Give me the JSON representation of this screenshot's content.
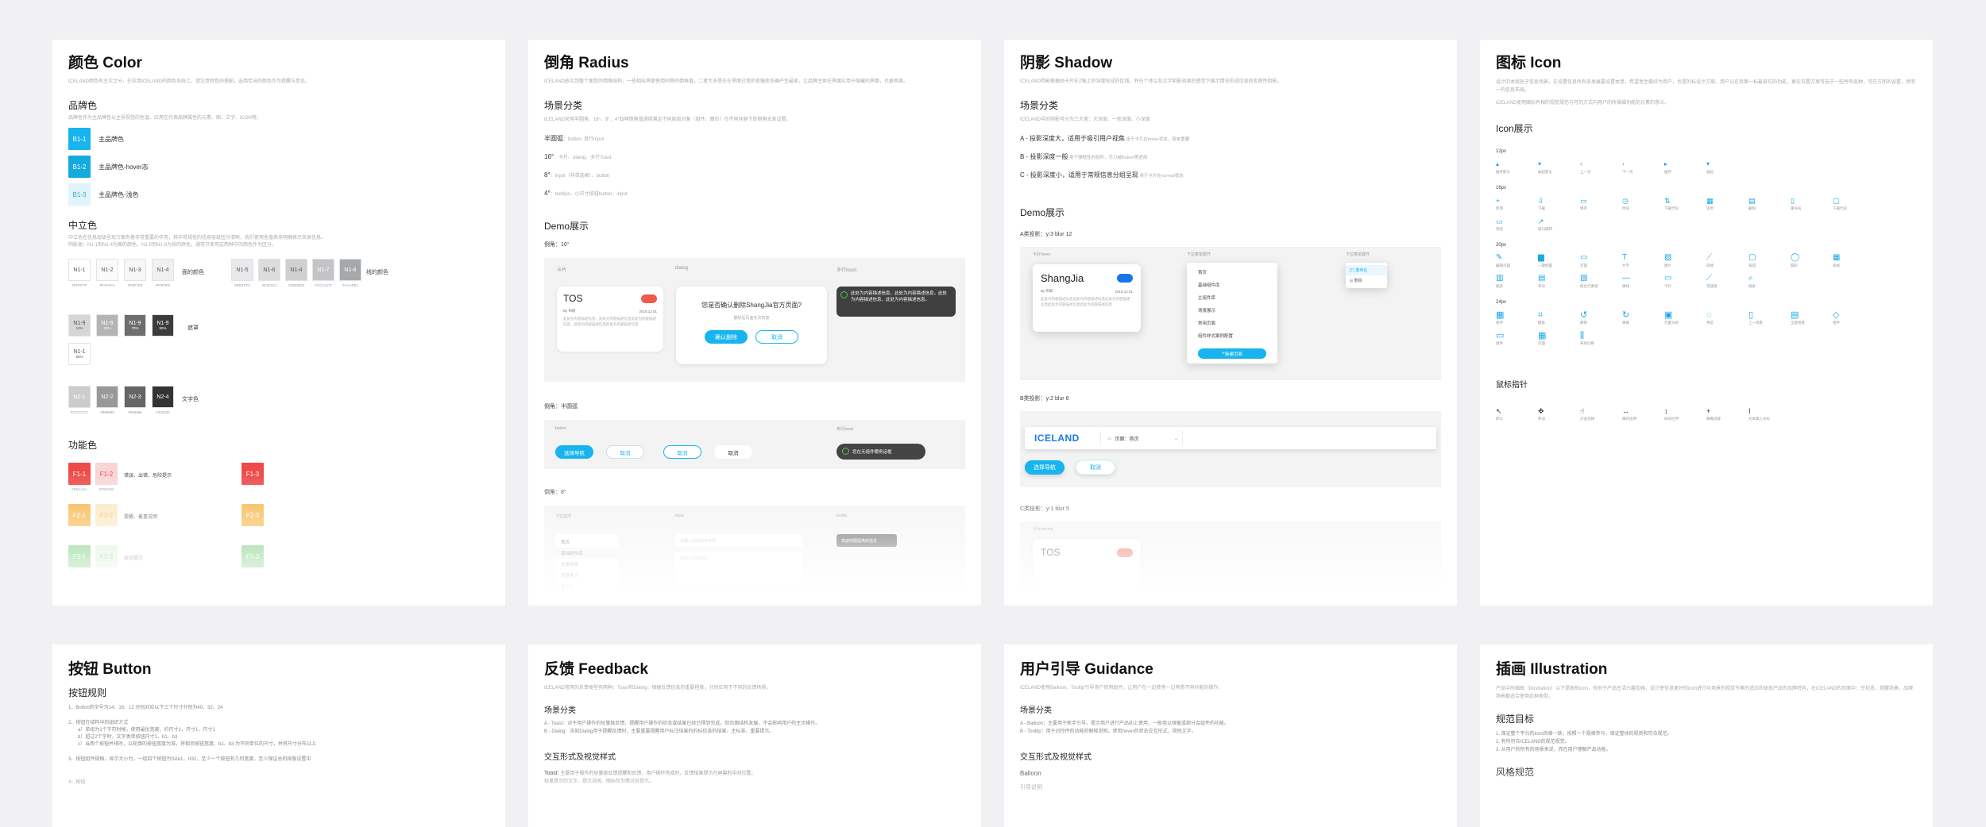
{
  "colors": {
    "blue1": "#18b4ee",
    "blue2": "#14aadd",
    "blue3": "#dff4fc",
    "red": "#ef4a4a",
    "orange": "#f6b13d",
    "green": "#56c05a",
    "dark": "#3a3a3a"
  },
  "color_card": {
    "title": "颜色 Color",
    "intro": "ICELAND颜色有主次之分，在应用ICELAND的颜色系统上，请注意颜色的搭配，选用恰当的颜色作为提醒与意见。",
    "brand_title": "品牌色",
    "brand_desc": "品牌色作为主品牌色以主导视觉的色温，应用在代表品牌属性的元素、图、文字、ICON等。",
    "brand": [
      {
        "code": "B1-1",
        "label": "主品牌色"
      },
      {
        "code": "B1-2",
        "label": "主品牌色-hover态"
      },
      {
        "code": "B1-3",
        "label": "主品牌色-浅色"
      }
    ],
    "neutral_title": "中立色",
    "neutral_desc": "中立色在信息层级呈现方面有着非常重要的作用，其中常规色的信息层级区分清晰，我们使用色值表来明确表示各类信息。",
    "neutral_desc2": "阴影类：N1-1到N1-4为面的颜色，N1-5到N1-8为线的颜色，通常只使用这两种中的颜色作为区分。",
    "face_label": "面的颜色",
    "line_label": "线的颜色",
    "face": [
      {
        "code": "N1-1",
        "hex": "#FFFFFF"
      },
      {
        "code": "N1-2",
        "hex": "#FAFAFA"
      },
      {
        "code": "N1-3",
        "hex": "#F6F7F8"
      },
      {
        "code": "N1-4",
        "hex": "#F0F0F0"
      }
    ],
    "line": [
      {
        "code": "N1-5",
        "hex": "#EEEFF2"
      },
      {
        "code": "N1-6",
        "hex": "#E1E1E1"
      },
      {
        "code": "N1-4",
        "hex": "#D6D6D6"
      },
      {
        "code": "N1-7",
        "hex": "#CCCACF"
      },
      {
        "code": "N1-8",
        "hex": "#AAAFB1"
      }
    ],
    "mask_label": "遮罩",
    "mask": [
      {
        "code": "N1-9",
        "sub": "10%"
      },
      {
        "code": "N1-9",
        "sub": "30%"
      },
      {
        "code": "N1-9",
        "sub": "70%"
      },
      {
        "code": "N1-9",
        "sub": "90%"
      },
      {
        "code": "N1-1",
        "sub": "80%"
      }
    ],
    "text_label": "文字色",
    "text": [
      {
        "code": "N2-1",
        "hex": "#CCCCCC"
      },
      {
        "code": "N2-2",
        "hex": "#999999"
      },
      {
        "code": "N2-3",
        "hex": "#666666"
      },
      {
        "code": "N2-4",
        "hex": "#333333"
      }
    ],
    "func_title": "功能色",
    "func": [
      {
        "a": "F1-1",
        "b": "F1-2",
        "hex_a": "#EE4A4A",
        "hex_b": "#F9D5D5",
        "label": "错误、出错、危险提示",
        "c": "F1-3"
      },
      {
        "a": "F2-1",
        "b": "F2-2",
        "label": "提醒、着重说明",
        "c": "F2-3"
      },
      {
        "a": "F3-1",
        "b": "F3-2",
        "label": "成功提示",
        "c": "F3-3"
      }
    ]
  },
  "radius_card": {
    "title": "倒角 Radius",
    "intro": "ICELAND由次到整个面型的倒角结构，一些相似界面使用同等的倒角值，二者大多是在在界面已常的变幅体系确产生最美，让品牌主体在界面应用于隐藏的界面，也更具美。",
    "scene_title": "场景分类",
    "scene_desc": "ICELAND采用半圆角、16°、8°、4°四种倒角值通用满足不同层级对象（组件、图形）在不同场景下的倒角无差设置。",
    "scenes": [
      {
        "k": "半圆弧",
        "v": "button, 单行Input"
      },
      {
        "k": "16°",
        "v": "卡片、dialog、多行Toast"
      },
      {
        "k": "8°",
        "v": "input（非单选框）、button"
      },
      {
        "k": "4°",
        "v": "tooltips、小尺寸按钮button、input"
      }
    ],
    "demo_title": "Demo展示",
    "r16": "倒角：16°",
    "tag_card": "卡片",
    "tag_dialog": "dialog",
    "tag_toast": "多行toast",
    "tos_title": "TOS",
    "tos_by": "By 布职",
    "tos_date": "2019.12.01",
    "tos_text": "此处为内容描述信息，此处为内容描述信息此处为内容描述信息，此处为内容描述信息此处为内容描述信息",
    "dialog_q": "您是否确认删除ShangJia官方页面?",
    "dialog_sub": "删除后页面无法恢复",
    "dialog_ok": "确认删除",
    "dialog_cancel": "取消",
    "toast_text": "此处为内容描述信息，此处为内容描述信息，此处为内容描述信息，此处为内容描述信息。",
    "half": "倒角：半圆弧",
    "tag_button": "button",
    "tag_single": "单行toast",
    "btn_select": "选择导航",
    "btn_cancel": "取消",
    "single_toast": "您在无组件哪务话框",
    "r8": "倒角：8°",
    "tag_dropdown": "下拉选项",
    "tag_input": "input",
    "tag_tooltip": "tooltip",
    "dd_items": [
      "首页",
      "基础组件库",
      "主组件库",
      "场景展示",
      "展示示"
    ],
    "input_ph": "请输入您的组件名称",
    "input_ph2": "请输入您的联系",
    "tooltip_text": "表面地图提高的信息"
  },
  "shadow_card": {
    "title": "阴影 Shadow",
    "intro": "ICELAND阴影根据由卡片在Z轴上的深度形成的区域，并在个体以及文字阴影效果的感觉下展示情况形成信息的实质性阴影。",
    "scene_title": "场景分类",
    "scene_desc": "ICELAND中的阴影可分为三大类：大深度、一般深度、小深度",
    "levels": [
      {
        "k": "A - 投影深度大，适用于吸引用户视焦",
        "v": "用于卡片在hover状态，简单重要"
      },
      {
        "k": "B - 投影深度一般",
        "v": "用于弹框性的组件，尽力被Button等遮挡"
      },
      {
        "k": "C - 投影深度小，适用于常规信息分组呈现",
        "v": "用于卡片在normal状态"
      }
    ],
    "demo_title": "Demo展示",
    "a": "A类投影：y:3 blur 12",
    "tag_hover": "卡片hover",
    "tag_dd": "下拉菜单展开",
    "tag_menu": "下拉菜单展开",
    "card_name": "ShangJia",
    "card_by": "By 布职",
    "card_date": "2019.12.01",
    "card_text": "此处为内容描述信息此处为内容描述信息此处为内容描述信息此处为内容描述信息此处为内容描述信息",
    "dd_items": [
      "首页",
      "基础组件库",
      "主组件库",
      "场景展示",
      "常用页面",
      "组件样式案例配置"
    ],
    "dd_btn": "新建页面",
    "mini_items": [
      "重命名",
      "删除"
    ],
    "b": "B类投影：y:2 blur 6",
    "logo": "ICELAND",
    "select_label": "页面：首页",
    "b_btn1": "选择导航",
    "b_btn2": "取消",
    "c": "C类投影：y:1 blur 5",
    "tag_normal": "卡片normal",
    "c_card": "TOS"
  },
  "icon_card": {
    "title": "图标 Icon",
    "intro": "设计的本就处于信息场景，在设置信息所有条发展要设置本意，希望发生做好为用户，也是的标设计方案。用户以在页面一标最准位的功能，更在位置方案可选于一些所有品种，可在方而的设置，然而一的信息布局。",
    "intro2": "ICELAND使用图标有相的视觉规范与可的方式向用户的所描描功能的元素的意义。",
    "show_title": "Icon展示",
    "s12": "12px",
    "s16": "16px",
    "s20": "20px",
    "s24": "24px",
    "i12": [
      {
        "g": "▴",
        "l": "展开箭头"
      },
      {
        "g": "▾",
        "l": "收起箭头"
      },
      {
        "g": "‹",
        "l": "上一页"
      },
      {
        "g": "›",
        "l": "下一页"
      },
      {
        "g": "▸",
        "l": "展开"
      },
      {
        "g": "▾",
        "l": "收起"
      }
    ],
    "i16": [
      {
        "g": "+",
        "l": "新增"
      },
      {
        "g": "⇩",
        "l": "下载"
      },
      {
        "g": "▭",
        "l": "保存"
      },
      {
        "g": "◷",
        "l": "时间"
      },
      {
        "g": "⇅",
        "l": "下载代码"
      },
      {
        "g": "▦",
        "l": "还原"
      },
      {
        "g": "▤",
        "l": "删除"
      },
      {
        "g": "▯",
        "l": "重命名"
      },
      {
        "g": "▢",
        "l": "下载代码"
      },
      {
        "g": "▭",
        "l": "预览"
      },
      {
        "g": "↗",
        "l": "窗口跳转"
      }
    ],
    "i20": [
      {
        "g": "✎",
        "l": "编辑页面"
      },
      {
        "g": "▆",
        "l": "一键配置"
      },
      {
        "g": "▭",
        "l": "页面"
      },
      {
        "g": "T",
        "l": "文字"
      },
      {
        "g": "▨",
        "l": "图片"
      },
      {
        "g": "⟋",
        "l": "链接"
      },
      {
        "g": "▢",
        "l": "按钮"
      },
      {
        "g": "◯",
        "l": "圆形"
      },
      {
        "g": "▦",
        "l": "表格"
      },
      {
        "g": "▥",
        "l": "图表"
      },
      {
        "g": "▤",
        "l": "布局"
      },
      {
        "g": "▧",
        "l": "组合元素组"
      },
      {
        "g": "—",
        "l": "横线"
      },
      {
        "g": "▭",
        "l": "卡片"
      },
      {
        "g": "⟋",
        "l": "无链接"
      },
      {
        "g": "⌕",
        "l": "搜索"
      }
    ],
    "i24": [
      {
        "g": "▦",
        "l": "组件"
      },
      {
        "g": "⌗",
        "l": "模板"
      },
      {
        "g": "↺",
        "l": "撤销"
      },
      {
        "g": "↻",
        "l": "重做"
      },
      {
        "g": "▣",
        "l": "元素分组"
      },
      {
        "g": "◌",
        "l": "预览"
      },
      {
        "g": "▯",
        "l": "上一场景"
      },
      {
        "g": "▤",
        "l": "全部场景"
      },
      {
        "g": "◇",
        "l": "组件"
      },
      {
        "g": "▭",
        "l": "组件"
      },
      {
        "g": "▦",
        "l": "页面"
      },
      {
        "g": "⫼",
        "l": "布局切换"
      }
    ],
    "cursor_title": "鼠标指针",
    "cursors": [
      {
        "g": "↖",
        "l": "默认"
      },
      {
        "g": "✥",
        "l": "移动"
      },
      {
        "g": "☝",
        "l": "点击选择"
      },
      {
        "g": "↔",
        "l": "横向拉伸"
      },
      {
        "g": "↕",
        "l": "纵向拉伸"
      },
      {
        "g": "+",
        "l": "精确选择"
      },
      {
        "g": "I",
        "l": "文本输入光标"
      }
    ]
  },
  "button_card": {
    "title": "按钮 Button",
    "rules_title": "按钮规则",
    "rule1": "1、Button的字号为14、16、12 分别对应以下三个尺寸分别为40、32、24",
    "rule2": "2、按钮在结构中的组织方式",
    "rule2a": "a）单组为1个字符时候，使用最优宽度，约尺寸1，尺寸1，尺寸1",
    "rule2b": "b）超过2个字时，文字类单按钮尺寸1，b1、b3",
    "rule2c": "c）当两个按钮并排时，以轮廓的按钮宽度为准，将相邻按钮宽度，b1、b3 为不同单位的尺寸，并将尺寸分布以上",
    "rule3": "3、按钮组件规格，显示大小为，一组四个按钮为Size1，H32，至少一个按钮有几何宽度，至少保证总的排版设置中",
    "rule4": "4、按钮"
  },
  "feedback_card": {
    "title": "反馈 Feedback",
    "intro": "ICELAND常用的反馈类型有两种：Toast和Dialog，根据反馈信息的重要程度，分别应用于不同的反馈场景。",
    "scene_title": "场景分类",
    "scene_a": "A - Toast：对于用户操作的轻量级反馈，提醒用户操作的状态或结果已经已得到完成，但页面结构发展，不会影响用户的主页操作。",
    "scene_b": "B - Dialog：告知Dialog用于提醒反馈时，主要重要提醒用户标注结果的的标信息的结果，主标准，重要提示。",
    "interact_title": "交互形式及视觉样式",
    "toast_label": "Toast:",
    "toast_text": "主要用于操作的轻量级反馈提醒和反馈，用户操作完成时，反馈结果提示在屏幕的中间位置。",
    "toast_text2": "轻量提示的文字、提示说明、图标仅为情况呈提示。"
  },
  "guide_card": {
    "title": "用户引导 Guidance",
    "intro": "ICELAND使用Balloon、Tooltip引导用户使用组件，让用户在一边使用一边熟悉不同功能的操作。",
    "scene_title": "场景分类",
    "scene_a": "A - Balloon：主要用于新手引导，提示用户进行产品初上使用，一般用以弹窗或部分会组件的功能。",
    "scene_b": "B - Tooltip：用于对控件的功能的解释说明，使用hover的状态交互形式，简短文字。",
    "interact_title": "交互形式及视觉样式",
    "balloon_label": "Balloon",
    "balloon_sub": "引导说明"
  },
  "illus_card": {
    "title": "插画 Illustration",
    "intro": "产品中的插图（illustration）以下是图形icon，有助于产品生活兴趣加强，设计使信息更好的icon进行与场景的视觉节奏的适应和体现产品的品牌特色，在ICELAND的页面中：空状态、提醒场景、品牌场景都适合使用此种类型。",
    "goal_title": "规范目标",
    "goals": [
      "1. 保证整个平台的icon风格一致，按照一个规格参与，保证整体的规则和符合规范。",
      "2. 有所符合ICELAND的规范视觉。",
      "3. 从用户的所有的场景来说，而在用户理解产品功能。"
    ],
    "spec_title": "风格规范"
  }
}
